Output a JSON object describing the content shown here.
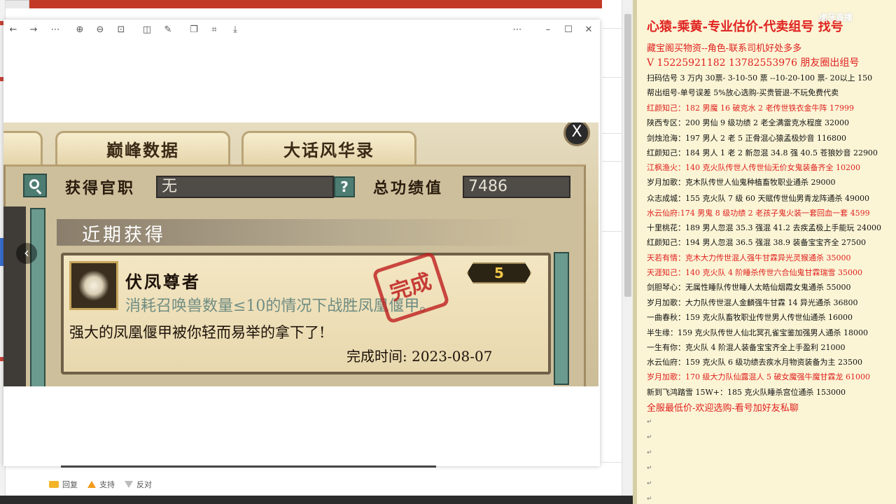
{
  "viewer": {
    "toolbar_icons": [
      "back-icon",
      "forward-icon",
      "grid-icon",
      "zoom-in-icon",
      "zoom-out-icon",
      "fit-icon",
      "crop-icon",
      "edit-icon",
      "copy-icon",
      "scan-icon",
      "download-icon",
      "more-icon",
      "minimize-icon",
      "maximize-icon",
      "close-icon"
    ],
    "glyphs": {
      "back": "←",
      "forward": "→",
      "grid": "⋯",
      "zoom_in": "⊕",
      "zoom_out": "⊖",
      "fit": "⊡",
      "crop": "◫",
      "edit": "✎",
      "copy": "❐",
      "scan": "⌗",
      "download": "⤓",
      "more": "⋯",
      "minimize": "–",
      "maximize": "☐",
      "close": "✕"
    }
  },
  "game": {
    "tabs": [
      "巅峰数据",
      "大话风华录"
    ],
    "close_label": "X",
    "official_label": "获得官职",
    "official_value": "无",
    "help_label": "?",
    "merit_label": "总功绩值",
    "merit_value": "7486",
    "section_title": "近期获得",
    "card": {
      "title": "伏凤尊者",
      "badge": "5",
      "stamp": "完成",
      "description": "消耗召唤兽数量≤10的情况下战胜凤凰偃甲。",
      "line2": "强大的凤凰偃甲被你轻而易举的拿下了!",
      "time_label": "完成时间:",
      "time_value": "2023-08-07"
    },
    "nav_left": "‹"
  },
  "reply_bar": {
    "reply": "回复",
    "support": "支持",
    "oppose": "反对"
  },
  "right_panel": {
    "title": "心猿-乘黄-专业估价-代卖组号 找号",
    "watermark": "虎牙直播",
    "lines": [
      {
        "text": "藏宝阁买物资--角色-联系司机好处多多",
        "style": "mid"
      },
      {
        "text": "V 15225921182   13782553976 朋友圈出组号",
        "style": "big"
      },
      {
        "text": "扫码估号 3 万内 30票- 3-10-50 票  --10-20-100 票- 20以上 150",
        "style": ""
      },
      {
        "text": "帮出组号-单号误差 5%放心选购-买贵管退-不玩免费代卖",
        "style": ""
      },
      {
        "text": "红颜知己：182 男魔 16 破克水 2 老传世铁衣金牛阵 17999",
        "style": "red"
      },
      {
        "text": "陕西专区：200 男仙 9 级功绩 2 老全满雷克水程度 32000",
        "style": ""
      },
      {
        "text": "剑烛沧海：197 男人 2 老 5 正骨混心猿孟极妙音 116800",
        "style": ""
      },
      {
        "text": "红颜知己：184 男人 1 老 2 新忽混 34.8 强 40.5 苍狼妙音 22900",
        "style": ""
      },
      {
        "text": "江枫渔火：140 克火队传世人传世仙无价女鬼装备齐全 10200",
        "style": "red"
      },
      {
        "text": "岁月加歌：克木队传世人仙鬼种植畜牧职业通杀 29000",
        "style": ""
      },
      {
        "text": "众志成城：155 克火队 7 级 60 天赋传世仙男青龙阵通杀 49000",
        "style": ""
      },
      {
        "text": "水云仙府:174 男鬼 8 级功绩 2 老孩子鬼火装一套回血一套 4599",
        "style": "red"
      },
      {
        "text": "十里桃花：189 男人忽混 35.3 强混 41.2 去疾孟极上手能玩 24000",
        "style": ""
      },
      {
        "text": "红颜知己：194 男人忽混 36.5 强混 38.9 装备宝宝齐全 27500",
        "style": ""
      },
      {
        "text": "天若有情：克木大力传世混人强牛甘霖异光灵猴通杀 35000",
        "style": "red"
      },
      {
        "text": "天涯知己：140 克火队 4 阶睡杀传世六合仙鬼甘霖瑞雪 35000",
        "style": "red"
      },
      {
        "text": "剑胆琴心：无属性睡队传世睡人太皓仙烟霞女鬼通杀 55000",
        "style": ""
      },
      {
        "text": "岁月加歌：大力队传世混人金麟强牛甘霖 14 异光通杀 36800",
        "style": ""
      },
      {
        "text": "一曲春秋：159 克火队畜牧职业传世男人传世仙通杀 16000",
        "style": ""
      },
      {
        "text": "半生缘：159 克火队传世人仙北冥孔雀宝鉴加强男人通杀 18000",
        "style": ""
      },
      {
        "text": "一生有你：克火队 4 阶混人装备宝宝齐全上手盈利 21000",
        "style": ""
      },
      {
        "text": "水云仙府：159 克火队 6 级功绩去疾水月物资装备为主 23500",
        "style": ""
      },
      {
        "text": "岁月加歌：170 级大力队仙露混人 5 破女魔强牛魔甘霖龙 61000",
        "style": "red"
      },
      {
        "text": "新到飞鸿踏雪 15W+：185 克火队睡杀宫位通杀 153000",
        "style": ""
      },
      {
        "text": "全服最低价-欢迎选购-看号加好友私聊",
        "style": "mid"
      }
    ],
    "para_mark": "↵"
  }
}
